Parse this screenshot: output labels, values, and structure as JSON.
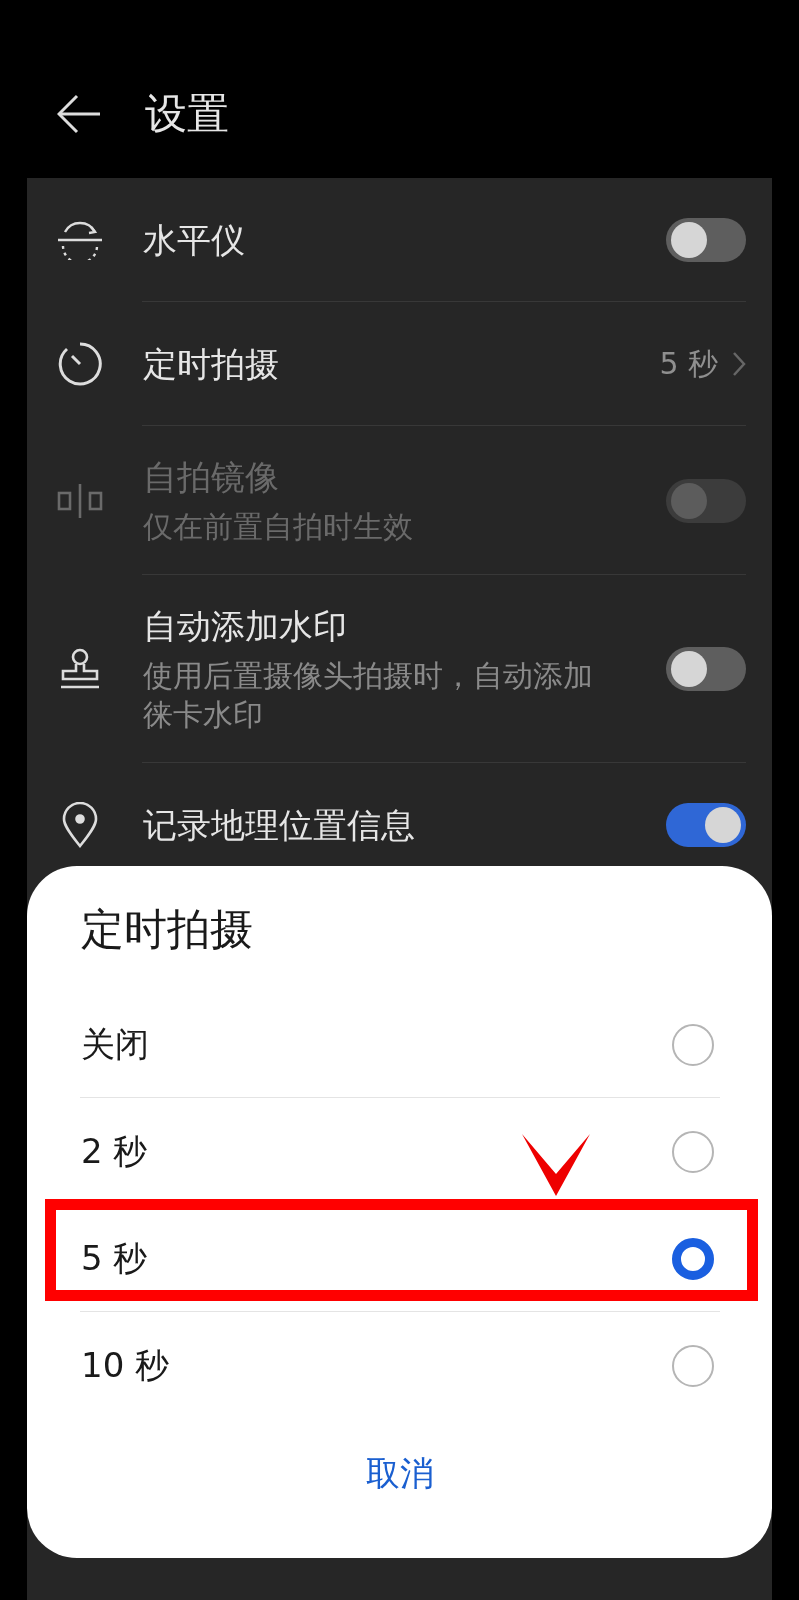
{
  "header": {
    "title": "设置"
  },
  "settings": [
    {
      "kind": "toggle",
      "title": "水平仪",
      "on": false,
      "disabled": false
    },
    {
      "kind": "link",
      "title": "定时拍摄",
      "value": "5 秒"
    },
    {
      "kind": "toggle",
      "title": "自拍镜像",
      "subtitle": "仅在前置自拍时生效",
      "on": false,
      "disabled": true
    },
    {
      "kind": "toggle",
      "title": "自动添加水印",
      "subtitle": "使用后置摄像头拍摄时，自动添加徕卡水印",
      "on": false,
      "disabled": false
    },
    {
      "kind": "toggle",
      "title": "记录地理位置信息",
      "on": true,
      "disabled": false
    }
  ],
  "dialog": {
    "title": "定时拍摄",
    "options": [
      {
        "label": "关闭",
        "selected": false,
        "highlighted": false
      },
      {
        "label": "2 秒",
        "selected": false,
        "highlighted": false
      },
      {
        "label": "5 秒",
        "selected": true,
        "highlighted": true
      },
      {
        "label": "10 秒",
        "selected": false,
        "highlighted": false
      }
    ],
    "cancel": "取消"
  }
}
